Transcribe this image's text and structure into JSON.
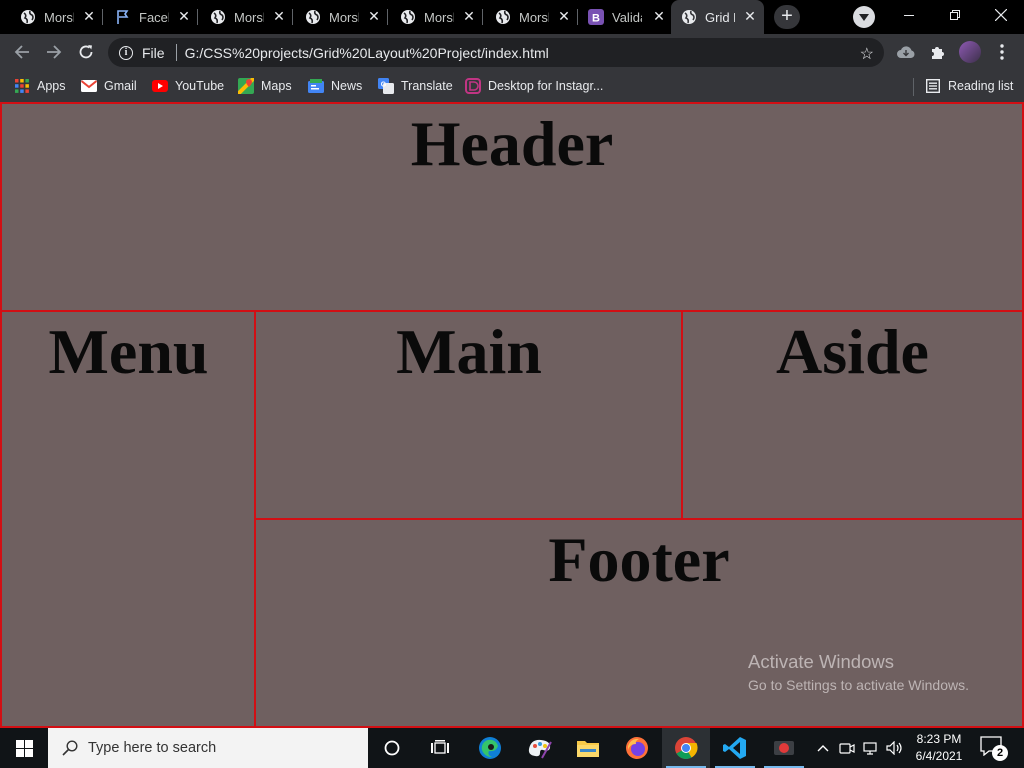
{
  "tabs": [
    {
      "title": "Morsh",
      "icon": "globe-icon",
      "active": false
    },
    {
      "title": "Faceb",
      "icon": "flag-icon",
      "active": false
    },
    {
      "title": "Morsh",
      "icon": "globe-icon",
      "active": false
    },
    {
      "title": "Morsh",
      "icon": "globe-icon",
      "active": false
    },
    {
      "title": "Morsh",
      "icon": "globe-icon",
      "active": false
    },
    {
      "title": "Morsh",
      "icon": "globe-icon",
      "active": false
    },
    {
      "title": "Valida",
      "icon": "bootstrap-icon",
      "active": false
    },
    {
      "title": "Grid L",
      "icon": "globe-icon",
      "active": true
    }
  ],
  "toolbar": {
    "scheme": "File",
    "url": "G:/CSS%20projects/Grid%20Layout%20Project/index.html"
  },
  "bookmarks": [
    {
      "label": "Apps",
      "icon": "apps-grid-icon"
    },
    {
      "label": "Gmail",
      "icon": "gmail-icon"
    },
    {
      "label": "YouTube",
      "icon": "youtube-icon"
    },
    {
      "label": "Maps",
      "icon": "maps-icon"
    },
    {
      "label": "News",
      "icon": "news-icon"
    },
    {
      "label": "Translate",
      "icon": "translate-icon"
    },
    {
      "label": "Desktop for Instagr...",
      "icon": "instagram-desktop-icon"
    }
  ],
  "reading_list": "Reading list",
  "grid": {
    "header": "Header",
    "menu": "Menu",
    "main": "Main",
    "aside": "Aside",
    "footer": "Footer"
  },
  "watermark": {
    "title": "Activate Windows",
    "subtitle": "Go to Settings to activate Windows."
  },
  "taskbar": {
    "search_placeholder": "Type here to search",
    "time": "8:23 PM",
    "date": "6/4/2021",
    "notification_count": "2"
  },
  "colors": {
    "page_background": "#6f6060",
    "cell_border": "#d20f14",
    "tab_active": "#35363a"
  }
}
